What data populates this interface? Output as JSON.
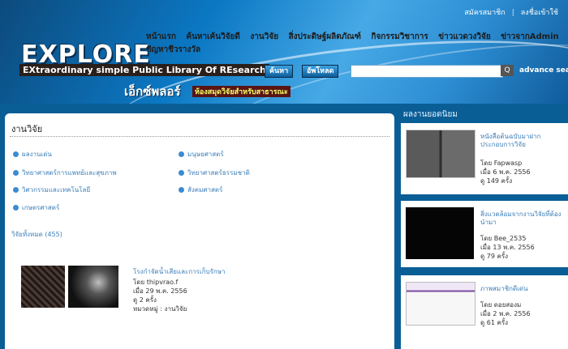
{
  "header": {
    "top_links": [
      "สมัครสมาชิก",
      "ลงชื่อเข้าใช้"
    ],
    "logo": "EXPLORE",
    "tagline": "EXtraordinary simple Public Library Of REsearch",
    "thai_logo": "เอ็กซ์พลอร์",
    "thai_subtitle": "ห้องสมุดวิจัยสำหรับสาธารณะ",
    "nav": [
      "หน้าแรก",
      "ค้นหาเค้นวิจัยดี",
      "งานวิจัย",
      "สิ่งประดิษฐ์ผลิตภัณฑ์",
      "กิจกรรมวิชาการ",
      "ข่าวแวดวงวิจัย",
      "ข่าวจากAdmin",
      "ปัญหาชีวรางวัล"
    ],
    "btn_research": "ค้นหา",
    "btn_upload": "อัพโหลด",
    "search_placeholder": "",
    "search_go": "Q",
    "advance": "advance search"
  },
  "main": {
    "title": "งานวิจัย",
    "categories_left": [
      "ผลงานเด่น",
      "วิทยาศาสตร์การแพทย์และสุขภาพ",
      "วิศวกรรมและเทคโนโลยี",
      "เกษตรศาสตร์"
    ],
    "categories_right": [
      "มนุษยศาสตร์",
      "วิทยาศาสตร์ธรรมชาติ",
      "สังคมศาสตร์"
    ],
    "count_text": "วิจัยทั้งหมด (455)",
    "item": {
      "title": "โรงกำจัดน้ำเสียและการเก็บรักษา",
      "by": "โดย thipvrao.f",
      "date": "เมื่อ 29 พ.ค. 2556",
      "views": "ดู 2 ครั้ง",
      "category": "หมวดหมู่ : งานวิจัย"
    }
  },
  "right": {
    "heading": "ผลงานยอดนิยม",
    "cards": [
      {
        "title": "หนังสือต้นฉบับมาฝาก ประกอบการวิจัย",
        "by": "โดย Fapwasp",
        "date": "เมื่อ 6 พ.ค. 2556",
        "views": "ดู 149 ครั้ง",
        "img": "#3b3b3b"
      },
      {
        "title": "สิ่งแวดล้อมจากงานวิจัยที่ต้องนำมา",
        "by": "โดย Bee_2535",
        "date": "เมื่อ 13 พ.ค. 2556",
        "views": "ดู 79 ครั้ง",
        "img": "#050505"
      },
      {
        "title": "ภาพสมาชิกดีเด่น",
        "by": "โดย ดอยสองม",
        "date": "เมื่อ 2 พ.ค. 2556",
        "views": "ดู 61 ครั้ง",
        "img": "#efe7f6"
      }
    ]
  }
}
